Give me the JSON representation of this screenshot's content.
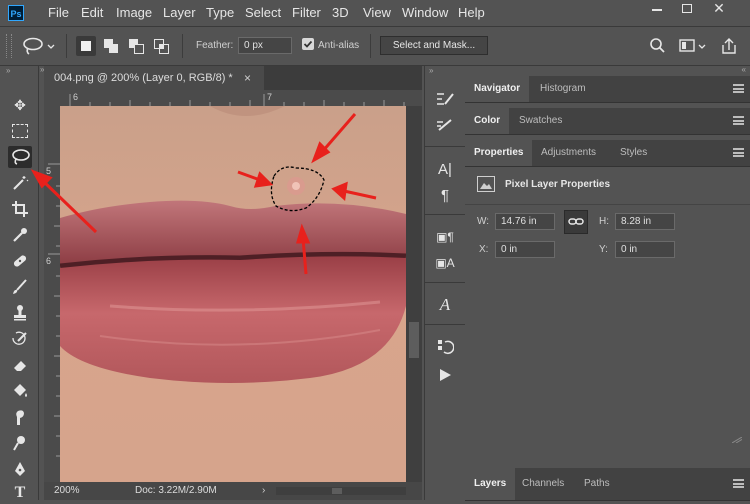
{
  "app": {
    "logo": "Ps"
  },
  "menu": {
    "items": [
      "File",
      "Edit",
      "Image",
      "Layer",
      "Type",
      "Select",
      "Filter",
      "3D",
      "View",
      "Window",
      "Help"
    ]
  },
  "options_bar": {
    "feather_label": "Feather:",
    "feather_value": "0 px",
    "antialias_label": "Anti-alias",
    "antialias_checked": true,
    "select_mask_label": "Select and Mask..."
  },
  "document": {
    "tab_title": "004.png @ 200% (Layer 0, RGB/8) *",
    "close_glyph": "×",
    "ruler_top": [
      "6",
      "7"
    ],
    "ruler_left": [
      "5",
      "6"
    ],
    "zoom": "200%",
    "doc_size": "Doc: 3.22M/2.90M"
  },
  "panels": {
    "group1_tabs": [
      "Navigator",
      "Histogram"
    ],
    "group2_tabs": [
      "Color",
      "Swatches"
    ],
    "group3_tabs": [
      "Properties",
      "Adjustments",
      "Styles"
    ],
    "properties": {
      "title": "Pixel Layer Properties",
      "w_label": "W:",
      "w_value": "14.76 in",
      "h_label": "H:",
      "h_value": "8.28 in",
      "x_label": "X:",
      "x_value": "0 in",
      "y_label": "Y:",
      "y_value": "0 in"
    },
    "bottom_tabs": [
      "Layers",
      "Channels",
      "Paths"
    ]
  },
  "colors": {
    "ui_bg": "#535353",
    "annotation_arrow": "#e8211c",
    "lip": "#b5585e",
    "skin": "#d9a08a"
  }
}
